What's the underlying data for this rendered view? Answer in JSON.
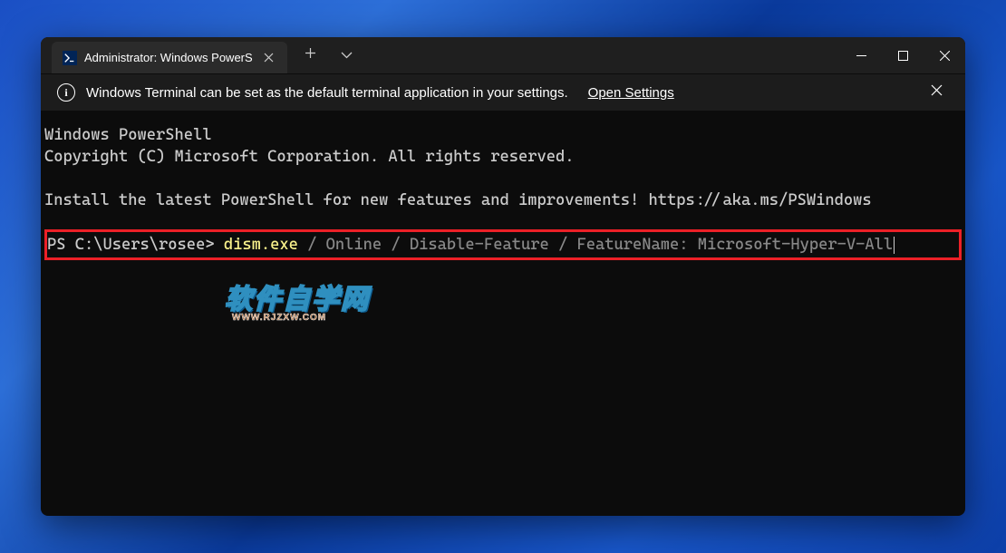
{
  "tab": {
    "title": "Administrator: Windows PowerS",
    "icon_label": ">_"
  },
  "notification": {
    "text": "Windows Terminal can be set as the default terminal application in your settings.",
    "link": "Open Settings"
  },
  "terminal": {
    "line1": "Windows PowerShell",
    "line2": "Copyright (C) Microsoft Corporation. All rights reserved.",
    "line3": "Install the latest PowerShell for new features and improvements! https://aka.ms/PSWindows",
    "prompt": "PS C:\\Users\\rosee> ",
    "cmd_executable": "dism.exe",
    "cmd_args": " / Online / Disable-Feature / FeatureName: Microsoft-Hyper-V-All"
  },
  "watermark": {
    "main": "软件自学网",
    "sub": "WWW.RJZXW.COM"
  }
}
